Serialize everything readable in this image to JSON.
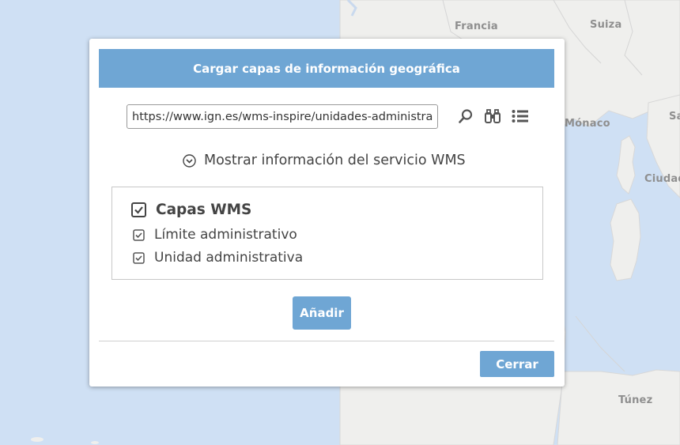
{
  "map": {
    "labels": {
      "francia": "Francia",
      "suiza": "Suiza",
      "monaco": "Mónaco",
      "sa": "Sa",
      "ciudad": "Ciudad",
      "tunez": "Túnez"
    },
    "colors": {
      "sea": "#cfe0f4",
      "land": "#efefed",
      "border": "#d5d5d5"
    }
  },
  "dialog": {
    "title": "Cargar capas de información geográfica",
    "url_value": "https://www.ign.es/wms-inspire/unidades-administrativas",
    "tools": [
      "search-icon",
      "binoculars-icon",
      "list-icon"
    ],
    "wms_info_label": "Mostrar información del servicio WMS",
    "layers": {
      "root": {
        "label": "Capas WMS",
        "checked": true
      },
      "children": [
        {
          "label": "Límite administrativo",
          "checked": true
        },
        {
          "label": "Unidad administrativa",
          "checked": true
        }
      ]
    },
    "add_label": "Añadir",
    "close_label": "Cerrar",
    "accent_color": "#6fa6d4"
  }
}
